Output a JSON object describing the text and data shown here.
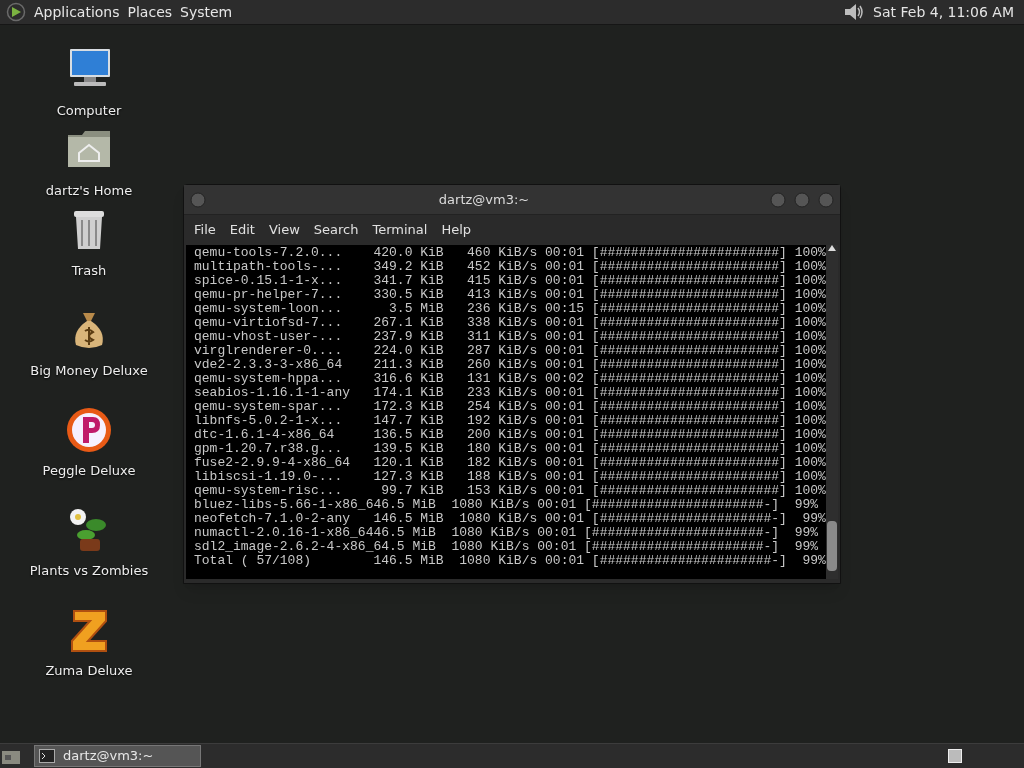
{
  "top_panel": {
    "menus": [
      "Applications",
      "Places",
      "System"
    ],
    "clock": "Sat Feb 4, 11:06 AM"
  },
  "desktop_icons": [
    {
      "label": "Computer",
      "kind": "computer"
    },
    {
      "label": "dartz's Home",
      "kind": "home"
    },
    {
      "label": "Trash",
      "kind": "trash"
    },
    {
      "label": "Big Money Deluxe",
      "kind": "moneybag"
    },
    {
      "label": "Peggle Deluxe",
      "kind": "peggle"
    },
    {
      "label": "Plants vs Zombies",
      "kind": "plant"
    },
    {
      "label": "Zuma Deluxe",
      "kind": "zuma"
    }
  ],
  "window": {
    "title": "dartz@vm3:~",
    "menu": [
      "File",
      "Edit",
      "View",
      "Search",
      "Terminal",
      "Help"
    ],
    "lines": [
      "qemu-tools-7.2.0...    420.0 KiB   460 KiB/s 00:01 [#######################] 100%",
      "multipath-tools-...    349.2 KiB   452 KiB/s 00:01 [#######################] 100%",
      "spice-0.15.1-1-x...    341.7 KiB   415 KiB/s 00:01 [#######################] 100%",
      "qemu-pr-helper-7...    330.5 KiB   413 KiB/s 00:01 [#######################] 100%",
      "qemu-system-loon...      3.5 MiB   236 KiB/s 00:15 [#######################] 100%",
      "qemu-virtiofsd-7...    267.1 KiB   338 KiB/s 00:01 [#######################] 100%",
      "qemu-vhost-user-...    237.9 KiB   311 KiB/s 00:01 [#######################] 100%",
      "virglrenderer-0....    224.0 KiB   287 KiB/s 00:01 [#######################] 100%",
      "vde2-2.3.3-3-x86_64    211.3 KiB   260 KiB/s 00:01 [#######################] 100%",
      "qemu-system-hppa...    316.6 KiB   131 KiB/s 00:02 [#######################] 100%",
      "seabios-1.16.1-1-any   174.1 KiB   233 KiB/s 00:01 [#######################] 100%",
      "qemu-system-spar...    172.3 KiB   254 KiB/s 00:01 [#######################] 100%",
      "libnfs-5.0.2-1-x...    147.7 KiB   192 KiB/s 00:01 [#######################] 100%",
      "dtc-1.6.1-4-x86_64     136.5 KiB   200 KiB/s 00:01 [#######################] 100%",
      "gpm-1.20.7.r38.g...    139.5 KiB   180 KiB/s 00:01 [#######################] 100%",
      "fuse2-2.9.9-4-x86_64   120.1 KiB   182 KiB/s 00:01 [#######################] 100%",
      "libiscsi-1.19.0-...    127.3 KiB   188 KiB/s 00:01 [#######################] 100%",
      "qemu-system-risc...     99.7 KiB   153 KiB/s 00:01 [#######################] 100%",
      "bluez-libs-5.66-1-x86_646.5 MiB  1080 KiB/s 00:01 [######################-]  99%",
      "neofetch-7.1.0-2-any   146.5 MiB  1080 KiB/s 00:01 [######################-]  99%",
      "numactl-2.0.16-1-x86_6446.5 MiB  1080 KiB/s 00:01 [######################-]  99%",
      "sdl2_image-2.6.2-4-x86_64.5 MiB  1080 KiB/s 00:01 [######################-]  99%",
      "Total ( 57/108)        146.5 MiB  1080 KiB/s 00:01 [######################-]  99%"
    ]
  },
  "taskbar": {
    "tasks": [
      {
        "label": "dartz@vm3:~",
        "selected": true
      }
    ]
  }
}
